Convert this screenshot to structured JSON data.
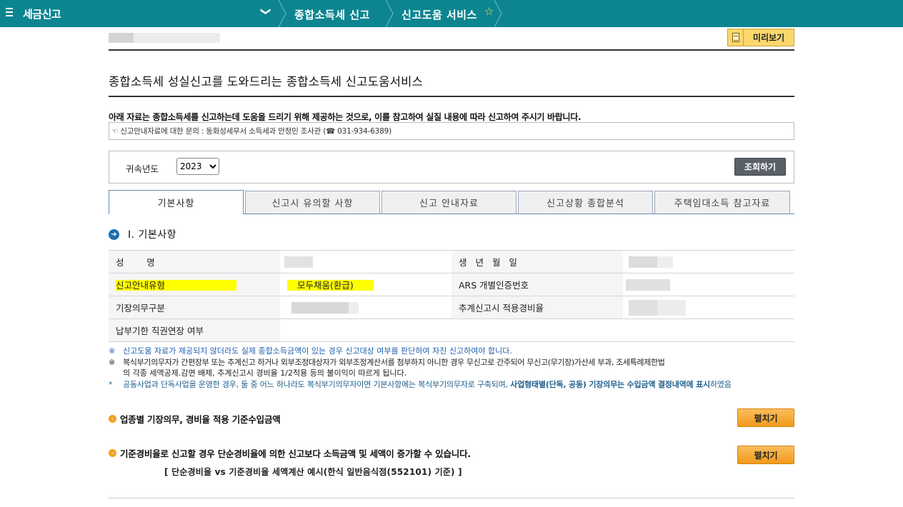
{
  "topbar": {
    "home_label": "세금신고",
    "breadcrumb_1": "종합소득세 신고",
    "breadcrumb_2": "신고도움 서비스",
    "dropdown_glyph": "❯",
    "star_glyph": "☆"
  },
  "header": {
    "preview_label": "미리보기",
    "main_title": "종합소득세 성실신고를 도와드리는 종합소득세 신고도움서비스",
    "notice": "아래 자료는 종합소득세를 신고하는데 도움을 드리기 위해 제공하는 것으로, 이를 참고하여 실질 내용에 따라 신고하여 주시기 바랍니다.",
    "inquiry": "☜ 신고안내자료에 대한 문의 : 동화성세무서 소득세과 안정민 조사관 (☎ 031-934-6389)"
  },
  "search": {
    "year_label": "귀속년도",
    "year_value": "2023",
    "query_button": "조회하기"
  },
  "tabs": [
    {
      "label": "기본사항",
      "active": true
    },
    {
      "label": "신고시 유의할 사항",
      "active": false
    },
    {
      "label": "신고 안내자료",
      "active": false
    },
    {
      "label": "신고상황 종합분석",
      "active": false
    },
    {
      "label": "주택임대소득 참고자료",
      "active": false
    }
  ],
  "section": {
    "title": "Ⅰ. 기본사항",
    "rows": [
      {
        "label1": "성        명",
        "value1": "",
        "label2": "생 년 월 일",
        "value2": ""
      },
      {
        "label1": "신고안내유형",
        "value1": "모두채움(환급)",
        "label2": "ARS 개별인증번호",
        "value2": ""
      },
      {
        "label1": "기장의무구분",
        "value1": "",
        "label2": "추계신고시 적용경비율",
        "value2": ""
      },
      {
        "label1": "납부기한 직권연장 여부",
        "value1": "",
        "label2": "",
        "value2": ""
      }
    ]
  },
  "notes": {
    "mark1": "※",
    "note1": "신고도움 자료가 제공되지 않더라도 실제 종합소득금액이 있는 경우 신고대상 여부를 판단하여 자진 신고하여야 합니다.",
    "mark2": "※",
    "note2a": "복식부기의무자가 간편장부 또는 추계신고 하거나 외부조정대상자가 외부조정계산서를 첨부하지 아니한 경우 무신고로 간주되어 무신고(무기장)가산세 부과, 조세특례제한법",
    "note2b": "의 각종 세액공제.감면 배제, 추계신고시 경비율 1/2적용 등의 불이익이 따르게 됩니다.",
    "mark3": "*",
    "note3a": "공동사업과 단독사업을 운영한 경우, 둘 중 어느 하나라도 복식부기의무자이면 기본사항에는 복식부기의무자로 구축되며, ",
    "note3b": "사업형태별(단독, 공동) 기장의무는 수입금액 결정내역에 표시",
    "note3c": "하였음"
  },
  "sub1": {
    "title": "업종별 기장의무, 경비율 적용 기준수입금액",
    "button": "펼치기"
  },
  "sub2": {
    "title": "기준경비율로 신고할 경우 단순경비율에 의한 신고보다 소득금액 및 세액이 증가할 수 있습니다.",
    "button": "펼치기"
  },
  "example_line": "[ 단순경비율 vs 기준경비율 세액계산 예시(한식 일반음식점(552101) 기준) ]",
  "colors": {
    "topbar": "#0d8590",
    "accent_orange": "#f19a1c",
    "highlight": "#ffff00",
    "note_blue": "#1f5fb0"
  }
}
